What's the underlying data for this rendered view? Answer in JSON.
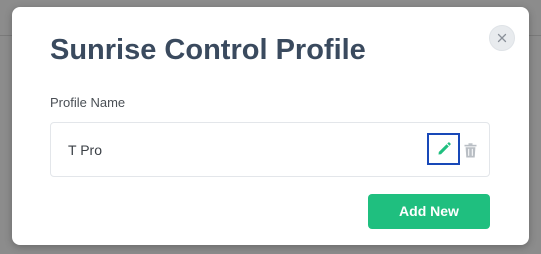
{
  "modal": {
    "title": "Sunrise Control Profile",
    "close_icon": "close-icon"
  },
  "form": {
    "field_label": "Profile Name",
    "profiles": [
      {
        "name": "T Pro",
        "actions": [
          "pencil-icon",
          "trash-icon"
        ]
      }
    ]
  },
  "actions": {
    "add_new_label": "Add New"
  },
  "colors": {
    "accent_green": "#1fbf7f",
    "title_text": "#3a4a5e",
    "focus_outline": "#1848b8",
    "trash_gray": "#b9bec4"
  }
}
